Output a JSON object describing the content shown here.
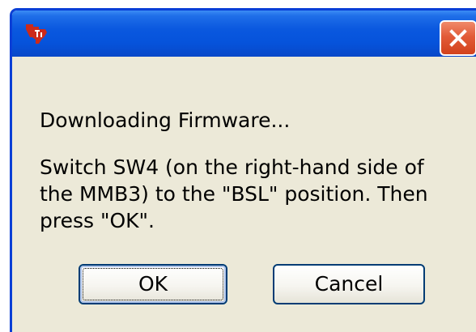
{
  "window": {
    "icon": "texas-instruments-logo-icon",
    "close_icon": "close-icon",
    "colors": {
      "titlebar": "#0a58df",
      "close_button": "#e25b38",
      "body": "#ece9d8",
      "icon": "#cc2a1b"
    }
  },
  "message": {
    "line1": "Downloading Firmware...",
    "body_lines": [
      "Switch SW4 (on the right-hand side of",
      "the MMB3) to the \"BSL\" position. Then",
      "press \"OK\"."
    ]
  },
  "buttons": {
    "ok_label": "OK",
    "cancel_label": "Cancel"
  }
}
